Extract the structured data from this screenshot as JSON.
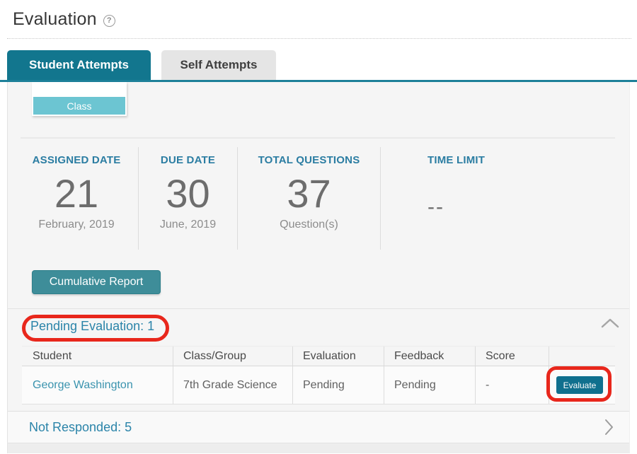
{
  "page": {
    "title": "Evaluation"
  },
  "icons": {
    "help": "?",
    "collapse": "chevron-up",
    "expand": "chevron-right"
  },
  "tabs": [
    {
      "label": "Student Attempts",
      "active": true
    },
    {
      "label": "Self Attempts",
      "active": false
    }
  ],
  "class_dropdown": {
    "label": "Class"
  },
  "stats": [
    {
      "label": "ASSIGNED DATE",
      "value": "21",
      "sub": "February, 2019"
    },
    {
      "label": "DUE DATE",
      "value": "30",
      "sub": "June, 2019"
    },
    {
      "label": "TOTAL QUESTIONS",
      "value": "37",
      "sub": "Question(s)"
    },
    {
      "label": "TIME LIMIT",
      "value": "--",
      "sub": ""
    }
  ],
  "buttons": {
    "cumulative_report": "Cumulative Report",
    "evaluate": "Evaluate"
  },
  "sections": {
    "pending": {
      "title": "Pending Evaluation: 1"
    },
    "not_responded": {
      "title": "Not Responded: 5"
    }
  },
  "table": {
    "headers": [
      "Student",
      "Class/Group",
      "Evaluation",
      "Feedback",
      "Score",
      ""
    ],
    "rows": [
      {
        "student": "George Washington",
        "class_group": "7th Grade Science",
        "evaluation": "Pending",
        "feedback": "Pending",
        "score": "-"
      }
    ]
  },
  "colors": {
    "tab_active": "#12768e",
    "tab_underline": "#1d8099",
    "class_teal": "#6cc5d2",
    "button_teal": "#3e8d99",
    "evaluate_teal": "#10708e",
    "link_teal": "#3a93ae",
    "section_title_teal": "#2b84a9",
    "stat_label_teal": "#2b7da2",
    "annotation_red": "#e8271c",
    "panel_bg": "#f5f5f5"
  }
}
